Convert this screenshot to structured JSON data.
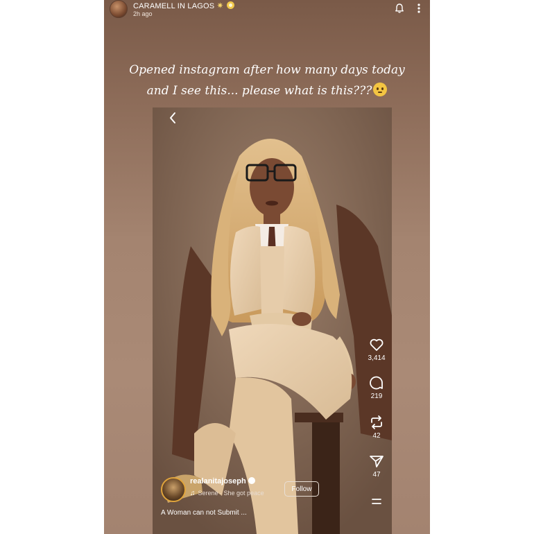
{
  "story": {
    "username": "CARAMELL IN LAGOS",
    "timestamp": "2h ago",
    "icons": [
      "bell-icon",
      "more-vertical-icon"
    ],
    "caption_line1": "Opened instagram after how many days today",
    "caption_line2": "and I see this... please what is this???",
    "caption_emoji": "flushed-face-emoji"
  },
  "reel": {
    "username": "realanitajoseph",
    "audio_artist": "Serene",
    "audio_separator": " · ",
    "audio_title": "She got peace",
    "follow_label": "Follow",
    "description": "A Woman can not Submit ...",
    "likes": "3,414",
    "comments": "219",
    "reposts": "42",
    "shares": "47",
    "icons": [
      "back-arrow-icon",
      "heart-icon",
      "comment-icon",
      "repost-icon",
      "send-icon",
      "menu-icon"
    ]
  },
  "colors": {
    "story_background": "#a48470",
    "reel_background": "#8a6f5c",
    "text": "#ffffff",
    "hair": "#d9b27a",
    "suit": "#e8cfad",
    "coat": "#5e3a2a"
  }
}
